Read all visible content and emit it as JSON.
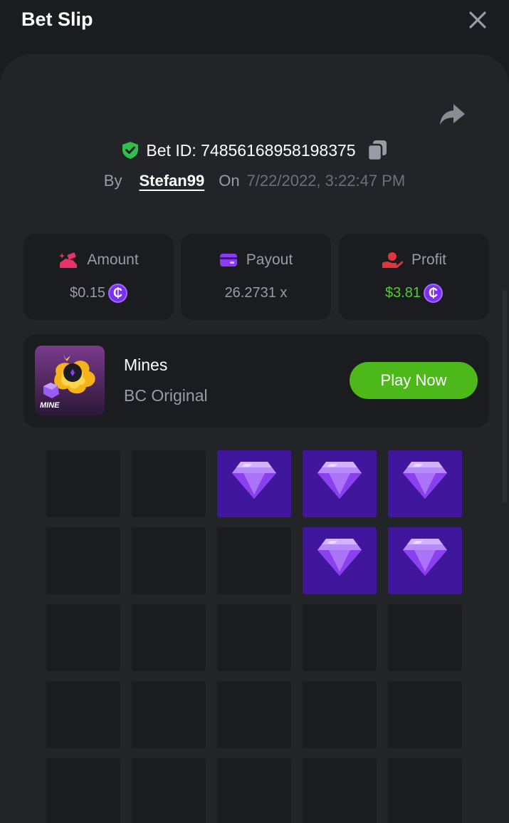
{
  "header": {
    "title": "Bet Slip"
  },
  "bet": {
    "id_text": "Bet ID: 74856168958198375",
    "by_label": "By",
    "username": "Stefan99",
    "on_label": "On",
    "datetime": "7/22/2022, 3:22:47 PM"
  },
  "stats": {
    "amount": {
      "label": "Amount",
      "value": "$0.15",
      "icon": "money-hand-icon"
    },
    "payout": {
      "label": "Payout",
      "value": "26.2731 x",
      "icon": "card-icon"
    },
    "profit": {
      "label": "Profit",
      "value": "$3.81",
      "icon": "profit-hand-icon"
    }
  },
  "coin_symbol": "₵",
  "game": {
    "name": "Mines",
    "provider": "BC Original",
    "thumb_label": "MINE",
    "play_label": "Play Now"
  },
  "grid": {
    "rows": [
      [
        "empty",
        "empty",
        "gem",
        "gem",
        "gem"
      ],
      [
        "empty",
        "empty",
        "empty",
        "gem",
        "gem"
      ],
      [
        "empty",
        "empty",
        "empty",
        "empty",
        "empty"
      ],
      [
        "empty",
        "empty",
        "empty",
        "empty",
        "empty"
      ],
      [
        "empty",
        "empty",
        "empty",
        "empty",
        "empty"
      ]
    ]
  },
  "colors": {
    "background": "#1b1c1f",
    "panel": "#232428",
    "accent_green": "#4cb81a",
    "profit_green": "#4fcf2a",
    "gem_cell": "#3f169c",
    "coin_purple": "#7b2ff0",
    "shield_green": "#2fbf4a"
  }
}
